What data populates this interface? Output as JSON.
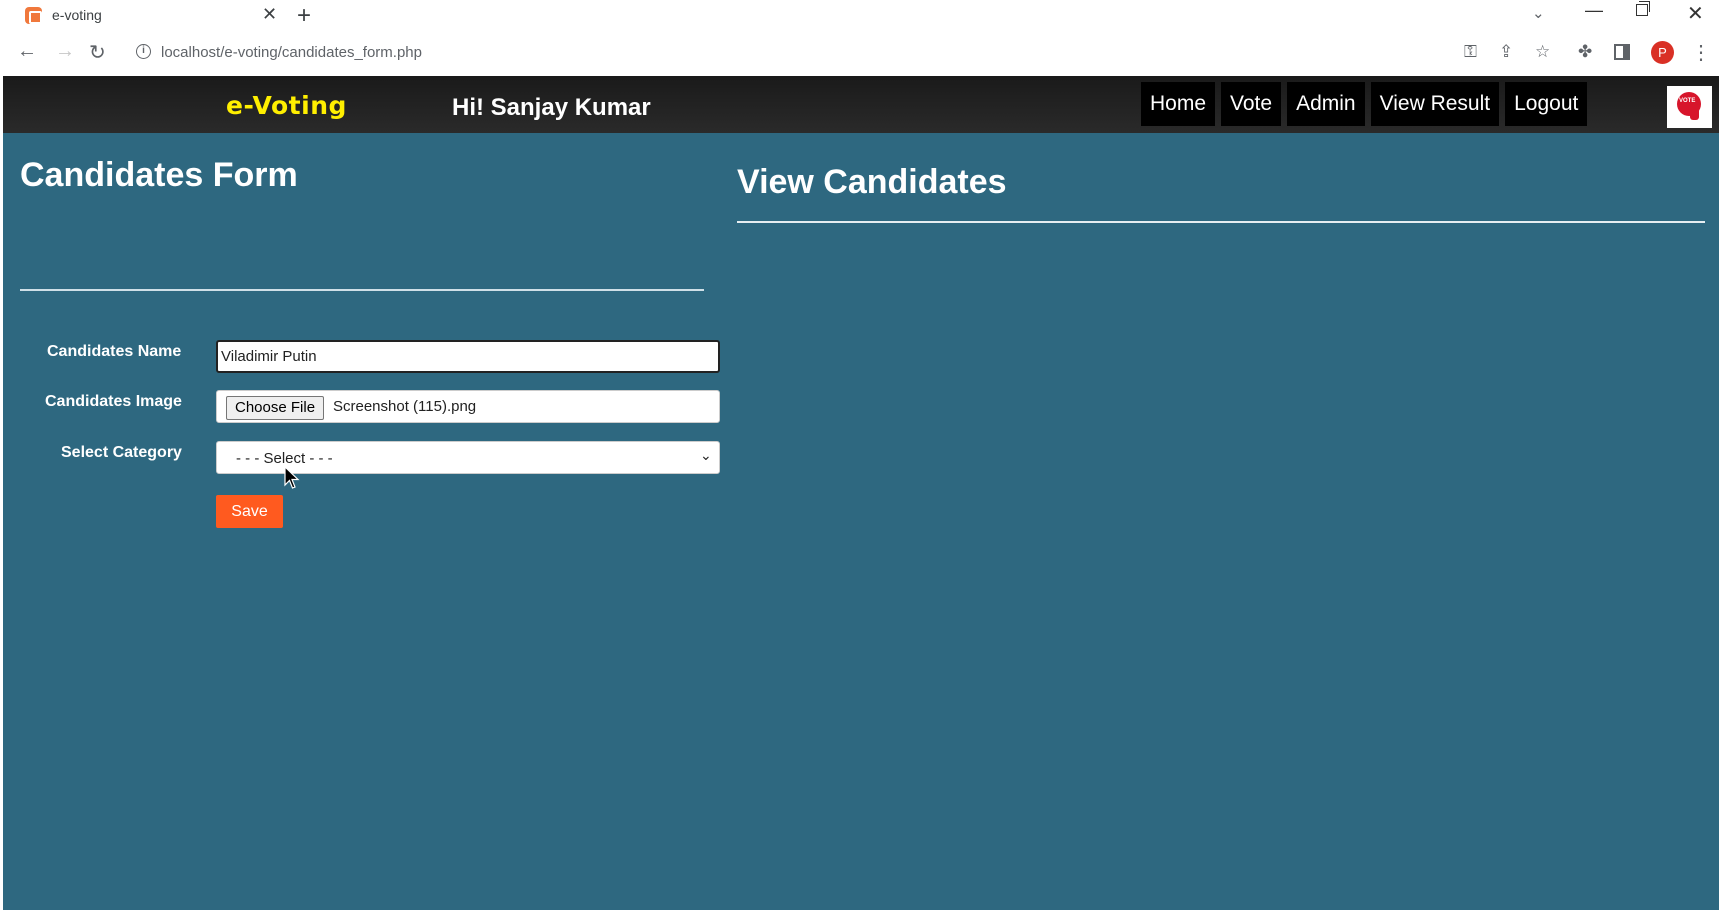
{
  "browser": {
    "tab_title": "e-voting",
    "url": "localhost/e-voting/candidates_form.php",
    "profile_initial": "P",
    "colors": {
      "profile": "#d93025",
      "favicon": "#f0783c"
    }
  },
  "header": {
    "brand": "e-Voting",
    "greeting": "Hi! Sanjay Kumar",
    "menu": [
      {
        "label": "Home"
      },
      {
        "label": "Vote"
      },
      {
        "label": "Admin"
      },
      {
        "label": "View Result"
      },
      {
        "label": "Logout"
      }
    ],
    "logo_icon": "vote-logo-icon"
  },
  "form": {
    "title": "Candidates Form",
    "name_label": "Candidates Name",
    "name_value": "Viladimir Putin",
    "image_label": "Candidates Image",
    "file_button": "Choose File",
    "file_name": "Screenshot (115).png",
    "category_label": "Select Category",
    "category_selected": "- - - Select - - -",
    "save_label": "Save"
  },
  "view": {
    "title": "View Candidates"
  },
  "colors": {
    "page_bg": "#2e6880",
    "navbar_bg": "#1f1f1f",
    "brand": "#ffef00",
    "save_button": "#ff5a1f"
  }
}
